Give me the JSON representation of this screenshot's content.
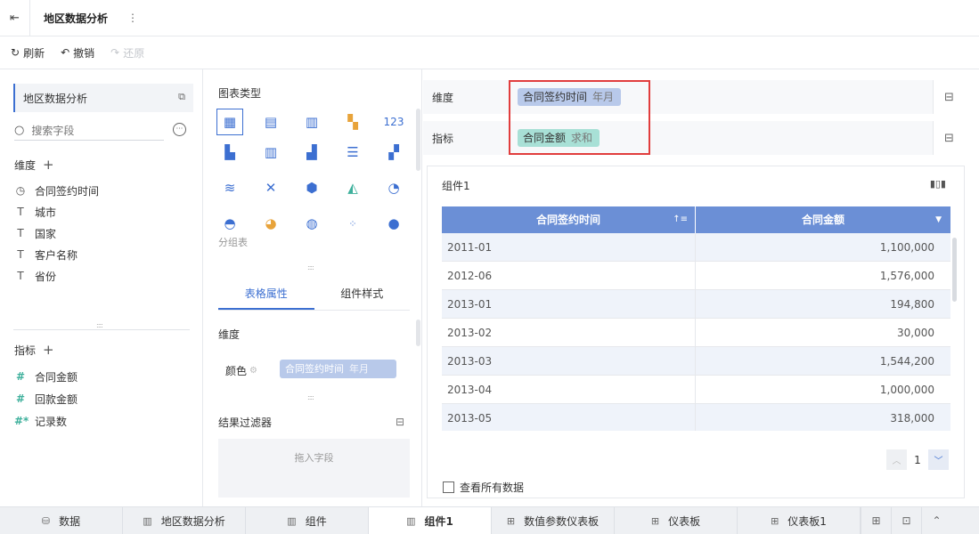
{
  "titlebar": {
    "back_icon": "exit-icon",
    "title": "地区数据分析",
    "more": "⋮"
  },
  "toolbar": {
    "refresh": "刷新",
    "undo": "撤销",
    "redo": "还原"
  },
  "left": {
    "dataset": "地区数据分析",
    "search_placeholder": "搜索字段",
    "dimension_title": "维度",
    "dimensions": [
      {
        "icon": "clock-icon",
        "label": "合同签约时间"
      },
      {
        "icon": "text-type-icon",
        "label": "城市"
      },
      {
        "icon": "text-type-icon",
        "label": "国家"
      },
      {
        "icon": "text-type-icon",
        "label": "客户名称"
      },
      {
        "icon": "text-type-icon",
        "label": "省份"
      }
    ],
    "measure_title": "指标",
    "measures": [
      {
        "icon": "number-type-icon",
        "label": "合同金额"
      },
      {
        "icon": "number-type-icon",
        "label": "回款金额"
      },
      {
        "icon": "record-count-icon",
        "label": "记录数"
      }
    ]
  },
  "middle": {
    "chart_type_title": "图表类型",
    "chart_type_label": "分组表",
    "tabs": [
      "表格属性",
      "组件样式"
    ],
    "active_tab": 0,
    "dim_title": "维度",
    "color_label": "颜色",
    "color_chip": {
      "label": "合同签约时间",
      "sub": "年月"
    },
    "filter_title": "结果过滤器",
    "drop_hint": "拖入字段"
  },
  "shelf": {
    "dimension": {
      "label": "维度",
      "chip": "合同签约时间",
      "sub": "年月",
      "color": "#b8c9ea"
    },
    "measure": {
      "label": "指标",
      "chip": "合同金额",
      "sub": "求和",
      "color": "#a8e0d6"
    }
  },
  "component": {
    "title": "组件1",
    "columns": [
      "合同签约时间",
      "合同金额"
    ],
    "rows": [
      [
        "2011-01",
        "1,100,000"
      ],
      [
        "2012-06",
        "1,576,000"
      ],
      [
        "2013-01",
        "194,800"
      ],
      [
        "2013-02",
        "30,000"
      ],
      [
        "2013-03",
        "1,544,200"
      ],
      [
        "2013-04",
        "1,000,000"
      ],
      [
        "2013-05",
        "318,000"
      ]
    ],
    "page": "1",
    "view_all": "查看所有数据"
  },
  "bottom_tabs": [
    {
      "icon": "database-icon",
      "label": "数据"
    },
    {
      "icon": "bar-chart-icon",
      "label": "地区数据分析"
    },
    {
      "icon": "bar-chart-icon",
      "label": "组件"
    },
    {
      "icon": "bar-chart-icon",
      "label": "组件1"
    },
    {
      "icon": "dashboard-icon",
      "label": "数值参数仪表板"
    },
    {
      "icon": "dashboard-icon",
      "label": "仪表板"
    },
    {
      "icon": "dashboard-icon",
      "label": "仪表板1"
    }
  ],
  "bottom_active": 3,
  "colors": {
    "accent": "#3c6fd1",
    "table_header": "#6b8fd6",
    "highlight": "#e13d3d"
  }
}
